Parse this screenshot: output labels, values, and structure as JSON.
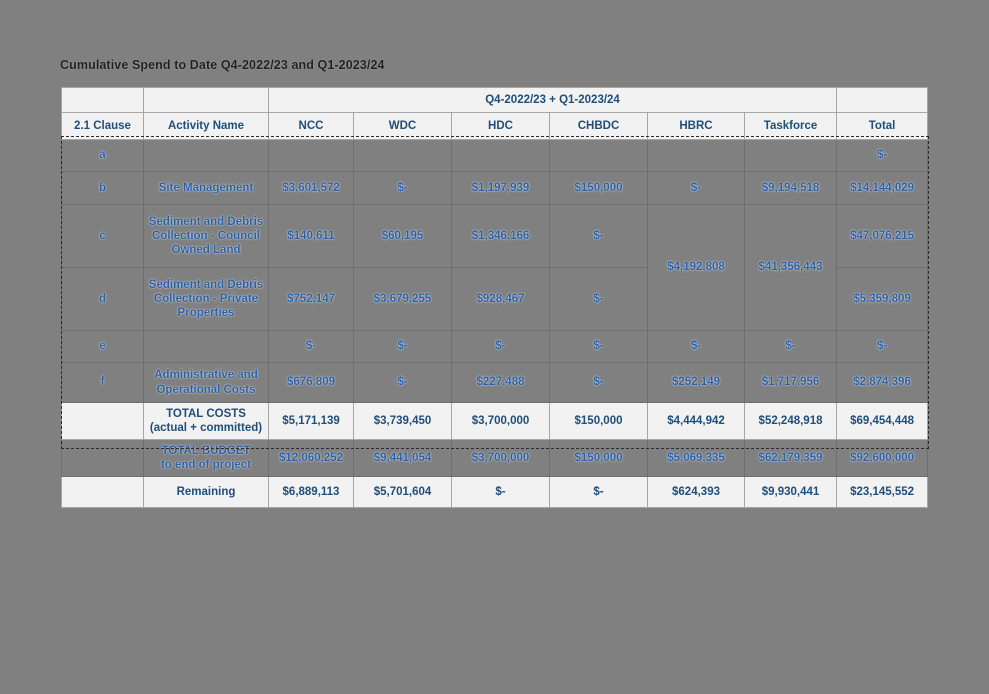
{
  "sheet": {
    "title": "Cumulative Spend to Date Q4-2022/23 and Q1-2023/24"
  },
  "table": {
    "group_header": "Q4-2022/23 + Q1-2023/24",
    "columns": [
      {
        "key": "clause",
        "label": "2.1 Clause"
      },
      {
        "key": "activity",
        "label": "Activity Name"
      },
      {
        "key": "ncc",
        "label": "NCC"
      },
      {
        "key": "wdc",
        "label": "WDC"
      },
      {
        "key": "hdc",
        "label": "HDC"
      },
      {
        "key": "chbdc",
        "label": "CHBDC"
      },
      {
        "key": "hbrc",
        "label": "HBRC"
      },
      {
        "key": "taskforce",
        "label": "Taskforce"
      },
      {
        "key": "total",
        "label": "Total"
      }
    ],
    "rows": [
      {
        "clause": "a",
        "activity": "",
        "ncc": "",
        "wdc": "",
        "hdc": "",
        "chbdc": "",
        "hbrc": "",
        "taskforce": "",
        "total": "$-"
      },
      {
        "clause": "b",
        "activity": "Site Management",
        "ncc": "$3,601,572",
        "wdc": "$-",
        "hdc": "$1,197,939",
        "chbdc": "$150,000",
        "hbrc": "$-",
        "taskforce": "$9,194,518",
        "total": "$14,144,029"
      },
      {
        "clause": "c",
        "activity": "Sediment and Debris Collection - Council Owned Land",
        "ncc": "$140,611",
        "wdc": "$60,195",
        "hdc": "$1,346,166",
        "chbdc": "$-",
        "hbrc": "$4,192,808",
        "taskforce": "$41,356,443",
        "total": "$47,076,215"
      },
      {
        "clause": "d",
        "activity": "Sediment and Debris Collection - Private Properties",
        "ncc": "$752,147",
        "wdc": "$3,679,255",
        "hdc": "$928,467",
        "chbdc": "$-",
        "hbrc": "",
        "taskforce": "",
        "total": "$5,359,809"
      },
      {
        "clause": "e",
        "activity": "",
        "ncc": "$-",
        "wdc": "$-",
        "hdc": "$-",
        "chbdc": "$-",
        "hbrc": "$-",
        "taskforce": "$-",
        "total": "$-"
      },
      {
        "clause": "f",
        "activity": "Administrative and Operational Costs",
        "ncc": "$676,809",
        "wdc": "$-",
        "hdc": "$227,488",
        "chbdc": "$-",
        "hbrc": "$252,149",
        "taskforce": "$1,717,956",
        "total": "$2,874,396"
      }
    ],
    "summary_rows": [
      {
        "label_line1": "TOTAL COSTS",
        "label_line2": "(actual + committed)",
        "selected": false,
        "ncc": "$5,171,139",
        "wdc": "$3,739,450",
        "hdc": "$3,700,000",
        "chbdc": "$150,000",
        "hbrc": "$4,444,942",
        "taskforce": "$52,248,918",
        "total": "$69,454,448"
      },
      {
        "label_line1": "TOTAL BUDGET",
        "label_line2": "to end of project",
        "selected": true,
        "ncc": "$12,060,252",
        "wdc": "$9,441,054",
        "hdc": "$3,700,000",
        "chbdc": "$150,000",
        "hbrc": "$5,069,335",
        "taskforce": "$62,179,359",
        "total": "$92,600,000"
      },
      {
        "label_line1": "Remaining",
        "label_line2": "",
        "selected": false,
        "ncc": "$6,889,113",
        "wdc": "$5,701,604",
        "hdc": "$-",
        "chbdc": "$-",
        "hbrc": "$624,393",
        "taskforce": "$9,930,441",
        "total": "$23,145,552"
      }
    ]
  },
  "colors": {
    "text_blue": "#1f4e79",
    "selection_grey": "#808080",
    "cell_background": "#f2f2f2",
    "grid_line": "#a6a6a6"
  }
}
